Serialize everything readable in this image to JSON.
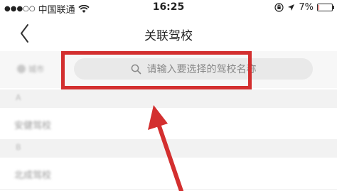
{
  "status_bar": {
    "signal_dots": "●●●○○",
    "carrier": "中国联通",
    "time": "16:25",
    "battery_percent": "7%",
    "battery_level": 0.07
  },
  "nav": {
    "title": "关联驾校",
    "back_icon": "chevron-left-icon"
  },
  "search": {
    "city_label": "城市",
    "placeholder": "请输入要选择的驾校名称"
  },
  "list": {
    "sections": [
      {
        "letter": "A",
        "items": [
          "安健驾校"
        ]
      },
      {
        "letter": "B",
        "items": [
          "北成驾校"
        ]
      }
    ]
  },
  "annotation": {
    "highlight_color": "#d32f2f",
    "arrow_color": "#d32f2f"
  }
}
